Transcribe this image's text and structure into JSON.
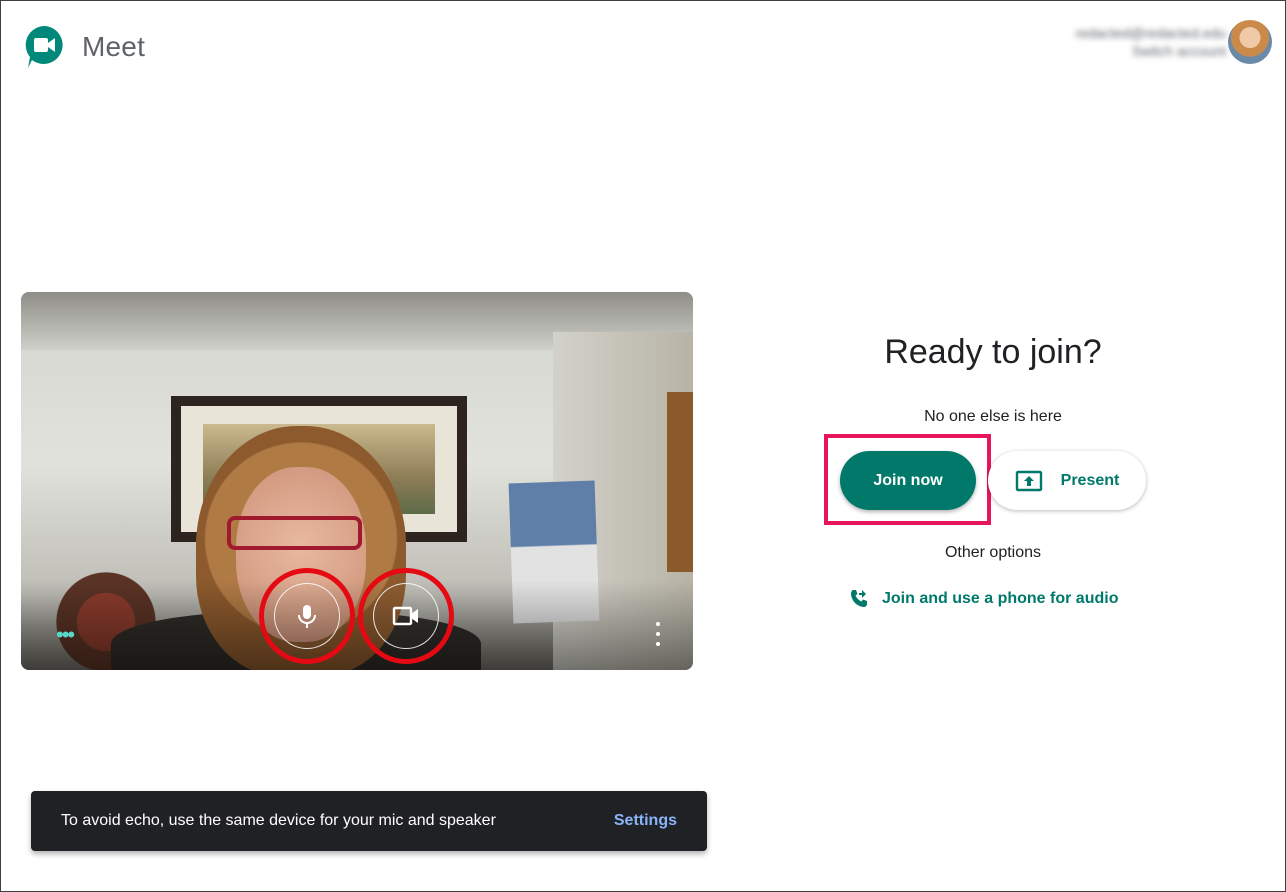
{
  "header": {
    "app_title": "Meet",
    "account_email": "redacted@redacted.edu",
    "account_switch": "Switch account"
  },
  "video": {
    "mic_button_icon": "mic-icon",
    "camera_button_icon": "videocam-icon",
    "more_options_icon": "more-vert-icon"
  },
  "join_panel": {
    "heading": "Ready to join?",
    "status": "No one else is here",
    "join_label": "Join now",
    "present_label": "Present",
    "other_options": "Other options",
    "phone_label": "Join and use a phone for audio"
  },
  "snackbar": {
    "message": "To avoid echo, use the same device for your mic and speaker",
    "action": "Settings"
  },
  "colors": {
    "accent": "#00796b",
    "highlight_box": "#e8155b",
    "highlight_ring": "#e50914",
    "snackbar_bg": "#202124",
    "snackbar_action": "#8ab4f8"
  }
}
